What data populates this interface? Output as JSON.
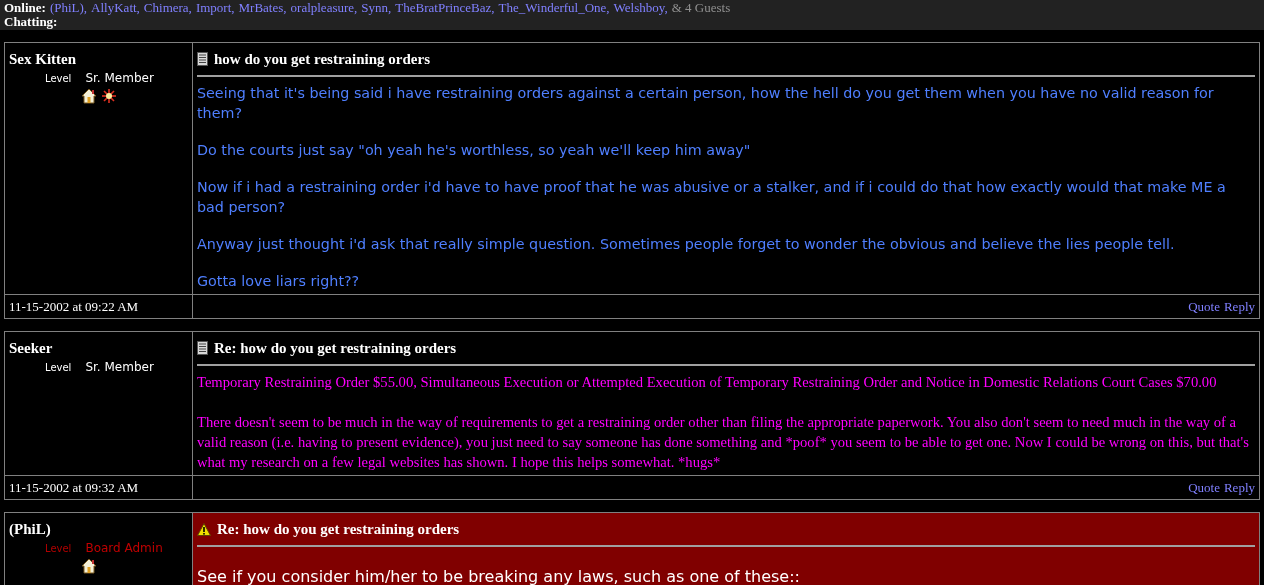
{
  "online_bar": {
    "online_label": "Online:",
    "users": [
      {
        "name": "(PhiL)",
        "sep": ","
      },
      {
        "name": "AllyKatt",
        "sep": ","
      },
      {
        "name": "Chimera",
        "sep": ","
      },
      {
        "name": "Import",
        "sep": ","
      },
      {
        "name": "MrBates",
        "sep": ","
      },
      {
        "name": "oralpleasure",
        "sep": ","
      },
      {
        "name": "Synn",
        "sep": ","
      },
      {
        "name": "TheBratPrinceBaz",
        "sep": ","
      },
      {
        "name": "The_Winderful_One",
        "sep": ","
      },
      {
        "name": "Welshboy",
        "sep": ","
      }
    ],
    "guests": "& 4 Guests",
    "chatting_label": "Chatting:"
  },
  "posts": [
    {
      "author": "Sex Kitten",
      "level_label": "Level",
      "rank": "Sr. Member",
      "admin": false,
      "author_icons": [
        {
          "kind": "house"
        },
        {
          "kind": "burst"
        }
      ],
      "title_icon": {
        "kind": "memo"
      },
      "title": "how do you get restraining orders",
      "highlighted": false,
      "body": {
        "kind": "sans",
        "color": "#4f7fff"
      },
      "paragraphs": [
        "Seeing that it's being said i have restraining orders against a certain person, how the hell do you get them when you have no valid reason for them?",
        "Do the courts just say \"oh yeah he's worthless, so yeah we'll keep him away\"",
        "Now if i had a restraining order i'd have to have proof that he was abusive or a stalker, and if i could do that how exactly would that make ME a bad person?",
        "Anyway just thought i'd ask that really simple question. Sometimes people forget to wonder the obvious and believe the lies people tell.",
        "Gotta love liars right??"
      ],
      "date": "11-15-2002 at 09:22 AM",
      "actions": [
        "Quote",
        "Reply"
      ]
    },
    {
      "author": "Seeker",
      "level_label": "Level",
      "rank": "Sr. Member",
      "admin": false,
      "title_icon": {
        "kind": "memo"
      },
      "title": "Re: how do you get restraining orders",
      "highlighted": false,
      "body": {
        "kind": "serif",
        "color": "#ff00ff"
      },
      "paragraphs": [
        "Temporary Restraining Order $55.00, Simultaneous Execution or Attempted Execution of Temporary Restraining Order and Notice in Domestic Relations Court Cases $70.00",
        "There doesn't seem to be much in the way of requirements to get a restraining order other than filing the appropriate paperwork. You also don't seem to need much in the way of a valid reason (i.e. having to present evidence), you just need to say someone has done something and *poof* you seem to be able to get one. Now I could be wrong on this, but that's what my research on a few legal websites has shown. I hope this helps somewhat. *hugs*"
      ],
      "date": "11-15-2002 at 09:32 AM",
      "actions": [
        "Quote",
        "Reply"
      ]
    },
    {
      "author": "(PhiL)",
      "level_label": "Level",
      "rank": "Board Admin",
      "admin": true,
      "author_icons": [
        {
          "kind": "house"
        }
      ],
      "title_icon": {
        "kind": "warning"
      },
      "title": "Re: how do you get restraining orders",
      "highlighted": true,
      "body": {
        "kind": "sans-large",
        "color": "#ffffff"
      },
      "paragraphs": [
        "See if you consider him/her to be breaking any laws, such as one of these::"
      ]
    }
  ]
}
